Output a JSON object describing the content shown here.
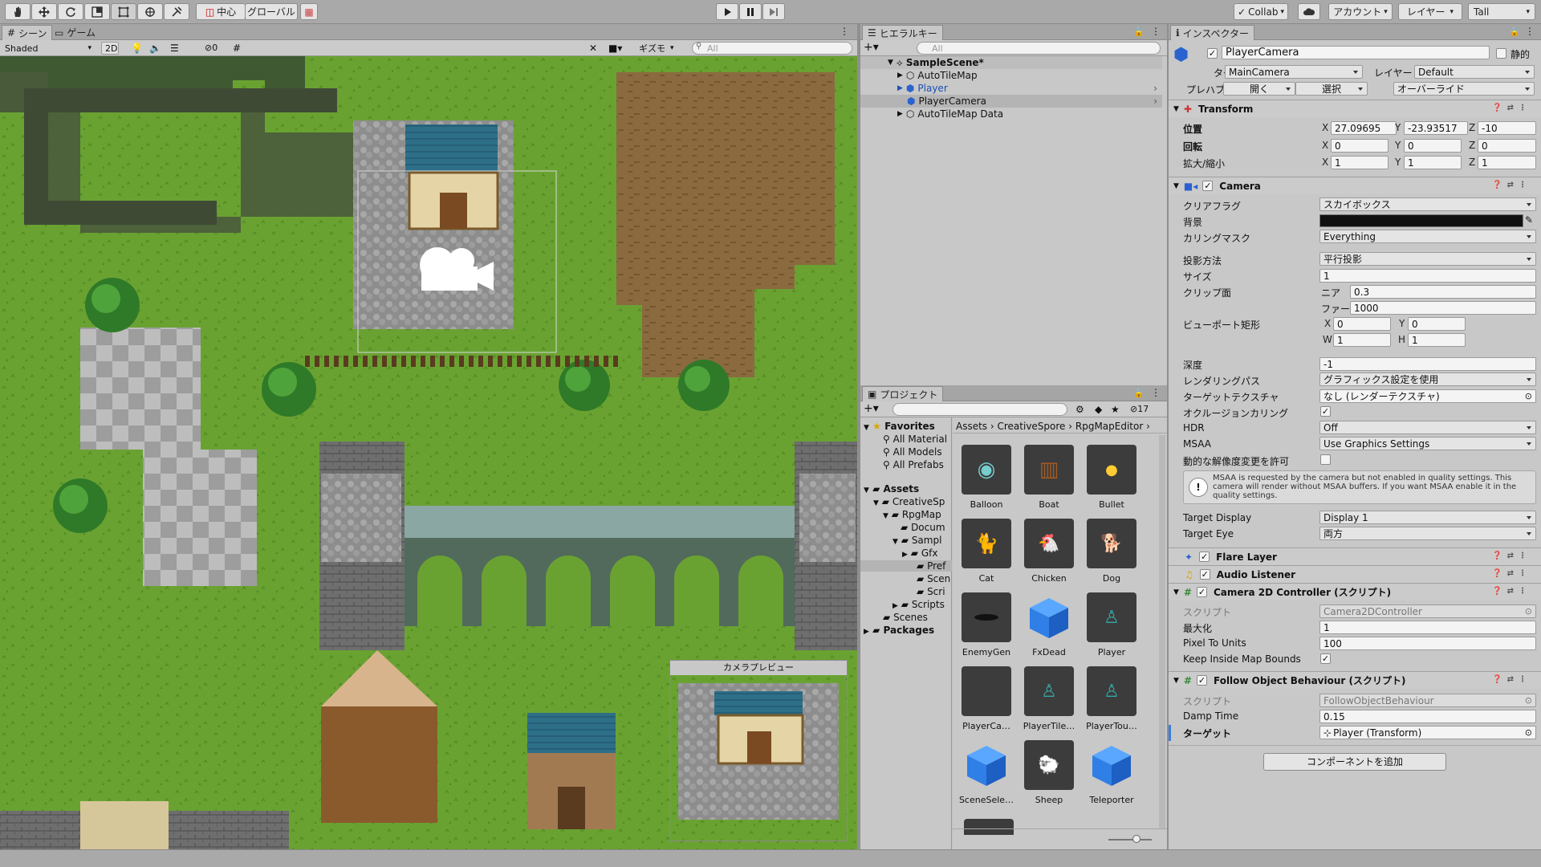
{
  "toolbar": {
    "pivot_label": "中心",
    "space_label": "グローバル",
    "collab_label": "Collab",
    "account_label": "アカウント",
    "layers_label": "レイヤー",
    "layout_label": "Tall"
  },
  "scene_panel": {
    "tab_scene": "シーン",
    "tab_game": "ゲーム",
    "shading_mode": "Shaded",
    "mode_2d": "2D",
    "hidden_count": "0",
    "gizmos_label": "ギズモ",
    "search_placeholder": "All",
    "camera_preview_title": "カメラプレビュー"
  },
  "hierarchy": {
    "tab_label": "ヒエラルキー",
    "search_placeholder": "All",
    "scene_name": "SampleScene*",
    "items": [
      {
        "label": "AutoTileMap",
        "color": "#111111"
      },
      {
        "label": "Player",
        "color": "#1d4fb6"
      },
      {
        "label": "PlayerCamera",
        "color": "#111111"
      },
      {
        "label": "AutoTileMap Data",
        "color": "#111111"
      }
    ]
  },
  "project": {
    "tab_label": "プロジェクト",
    "hidden_count": "17",
    "breadcrumb": [
      "Assets",
      "CreativeSpore",
      "RpgMapEditor"
    ],
    "favorites_label": "Favorites",
    "favorites": [
      "All Material",
      "All Models",
      "All Prefabs"
    ],
    "assets_label": "Assets",
    "tree": [
      "CreativeSp",
      "RpgMap",
      "Docum",
      "Sampl",
      "Gfx",
      "Pref",
      "Scen",
      "Scri",
      "Scripts",
      "Scenes"
    ],
    "packages_label": "Packages",
    "assets": [
      "Balloon",
      "Boat",
      "Bullet",
      "Cat",
      "Chicken",
      "Dog",
      "EnemyGen",
      "FxDead",
      "Player",
      "PlayerCa…",
      "PlayerTile…",
      "PlayerTou…",
      "SceneSele…",
      "Sheep",
      "Teleporter"
    ]
  },
  "inspector": {
    "tab_label": "インスペクター",
    "object_name": "PlayerCamera",
    "static_label": "静的",
    "tag_label": "タグ",
    "tag_value": "MainCamera",
    "layer_label": "レイヤー",
    "layer_value": "Default",
    "prefab_label": "プレハブ",
    "prefab_open": "開く",
    "prefab_select": "選択",
    "prefab_override": "オーバーライド",
    "transform": {
      "title": "Transform",
      "pos_label": "位置",
      "pos_x": "27.09695",
      "pos_y": "-23.93517",
      "pos_z": "-10",
      "rot_label": "回転",
      "rot_x": "0",
      "rot_y": "0",
      "rot_z": "0",
      "scale_label": "拡大/縮小",
      "scale_x": "1",
      "scale_y": "1",
      "scale_z": "1"
    },
    "camera": {
      "title": "Camera",
      "clear_flags_label": "クリアフラグ",
      "clear_flags_value": "スカイボックス",
      "background_label": "背景",
      "culling_mask_label": "カリングマスク",
      "culling_mask_value": "Everything",
      "projection_label": "投影方法",
      "projection_value": "平行投影",
      "size_label": "サイズ",
      "size_value": "1",
      "clipping_label": "クリップ面",
      "near_label": "ニア",
      "near_value": "0.3",
      "far_label": "ファー",
      "far_value": "1000",
      "viewport_label": "ビューポート矩形",
      "vp_x": "0",
      "vp_y": "0",
      "vp_w": "1",
      "vp_h": "1",
      "depth_label": "深度",
      "depth_value": "-1",
      "rendering_path_label": "レンダリングパス",
      "rendering_path_value": "グラフィックス設定を使用",
      "target_texture_label": "ターゲットテクスチャ",
      "target_texture_value": "なし (レンダーテクスチャ)",
      "occlusion_label": "オクルージョンカリング",
      "hdr_label": "HDR",
      "hdr_value": "Off",
      "msaa_label": "MSAA",
      "msaa_value": "Use Graphics Settings",
      "dynamic_res_label": "動的な解像度変更を許可",
      "msaa_warning": "MSAA is requested by the camera but not enabled in quality settings. This camera will render without MSAA buffers. If you want MSAA enable it in the quality settings.",
      "target_display_label": "Target Display",
      "target_display_value": "Display 1",
      "target_eye_label": "Target Eye",
      "target_eye_value": "両方"
    },
    "flare_layer_title": "Flare Layer",
    "audio_listener_title": "Audio Listener",
    "cam2d": {
      "title": "Camera 2D Controller (スクリプト)",
      "script_label": "スクリプト",
      "script_value": "Camera2DController",
      "zoom_label": "最大化",
      "zoom_value": "1",
      "ppu_label": "Pixel To Units",
      "ppu_value": "100",
      "bounds_label": "Keep Inside Map Bounds"
    },
    "follow": {
      "title": "Follow Object Behaviour (スクリプト)",
      "script_label": "スクリプト",
      "script_value": "FollowObjectBehaviour",
      "damp_label": "Damp Time",
      "damp_value": "0.15",
      "target_label": "ターゲット",
      "target_value": "Player (Transform)"
    },
    "add_component_label": "コンポーネントを追加"
  },
  "colors": {
    "selection": "#b4b4b4",
    "accent_blue": "#3a7de0",
    "grass": "#6aa232"
  }
}
